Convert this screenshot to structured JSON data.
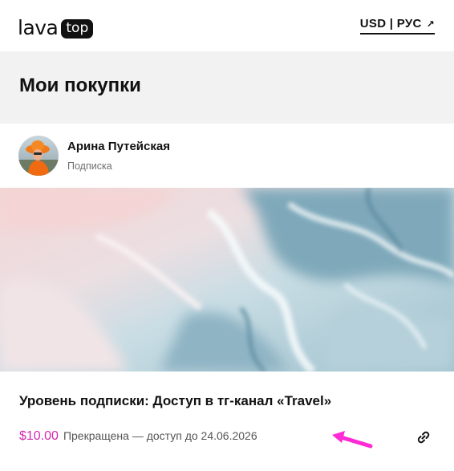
{
  "header": {
    "logo_word": "lava",
    "logo_badge": "top",
    "locale_label": "USD | РУС",
    "locale_arrow": "↗"
  },
  "page": {
    "title": "Мои покупки"
  },
  "author": {
    "name": "Арина Путейская",
    "type": "Подписка",
    "avatar_icon": "avatar-photo"
  },
  "purchase": {
    "title": "Уровень подписки: Доступ в тг-канал «Travel»",
    "price": "$10.00",
    "status": "Прекращена — доступ до 24.06.2026",
    "annotation_color": "#ff2bd6",
    "action_icon": "link-icon"
  },
  "colors": {
    "accent": "#d42ab0",
    "band": "#f2f2f2"
  }
}
